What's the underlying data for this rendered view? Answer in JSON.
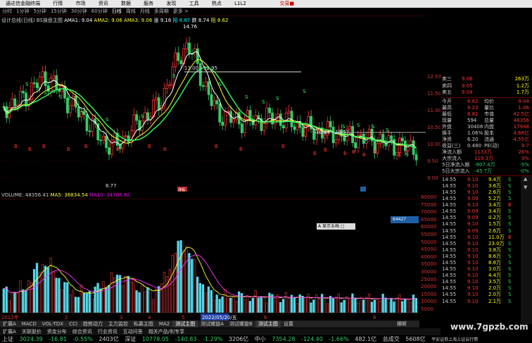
{
  "menubar": {
    "app": "通达信金融终端",
    "items": [
      "行情",
      "市场",
      "资讯",
      "数据",
      "服务",
      "发现",
      "工具",
      "热点",
      "L1L2"
    ],
    "right": "交易■"
  },
  "periods": [
    "分时",
    "1分钟",
    "5分钟",
    "15分钟",
    "30分钟",
    "60分钟",
    "日线",
    "周线",
    "月线",
    "多周期",
    "更多 >"
  ],
  "active_period": "日线",
  "legend_main": {
    "name": "设计总线(日线)",
    "ind": "BS操盘主图",
    "ma1": "AMA1: 9.04",
    "ma2": "AMA2: 9.06",
    "ma3": "AMA3: 9.06",
    "p1": "涨 9.16",
    "p2": "阳 8.87",
    "p3": "跌 8.74",
    "p4": "阳 8.62"
  },
  "main_annotations": {
    "high": "14.76",
    "resist": "13.00 - 12.95",
    "support": "10.59 - 10.57",
    "low": "8.77",
    "label_mid": "8.77",
    "mark": "涨幅"
  },
  "yaxis_main": [
    "12.53",
    "11.50",
    "11.00",
    "10.50",
    "10.00",
    "9.50",
    "9.00"
  ],
  "legend_vol": {
    "name": "VOLUME: 48356.41",
    "ma5": "MA5: 36834.54",
    "ma10": "MA10: 34706.80"
  },
  "yaxis_vol": [
    "80000",
    "75000",
    "70000",
    "65000",
    "60000",
    "55000",
    "50000",
    "45000",
    "40000",
    "35000",
    "30000",
    "25000",
    "20000",
    "15000",
    "10000",
    "5000"
  ],
  "vol_badge": "64427",
  "popup_label": "A 显示五档 ▢",
  "sidepanel": {
    "asks": [
      {
        "l": "卖三",
        "p": "9.06",
        "v": "263万"
      },
      {
        "l": "卖四",
        "p": "9.05",
        "v": "1.2万"
      },
      {
        "l": "卖五",
        "p": "9.04",
        "v": "1.7万"
      }
    ],
    "quote": [
      {
        "k": "今开",
        "v": "8.82",
        "k2": "均价",
        "v2": "9.04"
      },
      {
        "k": "最高",
        "v": "9.23",
        "k2": "量比",
        "v2": "1.06"
      },
      {
        "k": "最低",
        "v": "8.82",
        "k2": "市值",
        "v2": "42.5亿"
      },
      {
        "k": "现量",
        "v": "594",
        "k2": "总量",
        "v2": "48356"
      },
      {
        "k": "外盘",
        "v": "30408",
        "k2": "内盘",
        "v2": "17948"
      },
      {
        "k": "换手",
        "v": "1.06%",
        "k2": "股本",
        "v2": "4.68亿"
      },
      {
        "k": "净资",
        "v": "6.20",
        "k2": "流通",
        "v2": "4.55亿"
      },
      {
        "k": "收益(三)",
        "v": "0.480",
        "k2": "PE(动)",
        "v2": "9.7"
      },
      {
        "k": "净流入额",
        "v": "1133万",
        "k2": "",
        "v2": "26%"
      },
      {
        "k": "大宗流入",
        "v": "119.3万",
        "k2": "",
        "v2": "3%"
      },
      {
        "k": "5日净流入额",
        "v": "-907.4万",
        "k2": "",
        "v2": "-5%"
      },
      {
        "k": "5日大宗流入",
        "v": "-45.7万",
        "k2": "",
        "v2": "-0%"
      }
    ],
    "ticks": [
      {
        "t": "14:55",
        "p": "9.10",
        "n": "9.4万",
        "s": "S"
      },
      {
        "t": "14:55",
        "p": "9.10",
        "n": "3.6万",
        "s": "S"
      },
      {
        "t": "14:55",
        "p": "9.10",
        "n": "2.6万",
        "s": "S"
      },
      {
        "t": "14:55",
        "p": "9.09",
        "n": "5.2万",
        "s": "S"
      },
      {
        "t": "14:55",
        "p": "9.10",
        "n": "3.4万",
        "s": "B"
      },
      {
        "t": "14:55",
        "p": "9.09",
        "n": "3.4万",
        "s": "S"
      },
      {
        "t": "14:55",
        "p": "9.09",
        "n": "0.2万",
        "s": "S"
      },
      {
        "t": "14:55",
        "p": "9.10",
        "n": "1.5万",
        "s": "S"
      },
      {
        "t": "14:55",
        "p": "9.09",
        "n": "2.6万",
        "s": "S"
      },
      {
        "t": "14:55",
        "p": "9.10",
        "n": "11.0万",
        "s": "B"
      },
      {
        "t": "14:55",
        "p": "9.10",
        "n": "23.0万",
        "s": "S"
      },
      {
        "t": "14:55",
        "p": "9.10",
        "n": "3.8万",
        "s": "S"
      },
      {
        "t": "14:55",
        "p": "9.10",
        "n": "8.6万",
        "s": "S"
      },
      {
        "t": "14:55",
        "p": "9.10",
        "n": "8.8万",
        "s": "S"
      },
      {
        "t": "14:55",
        "p": "9.10",
        "n": "3.0万",
        "s": "S"
      },
      {
        "t": "14:55",
        "p": "9.10",
        "n": "4.4万",
        "s": "S"
      },
      {
        "t": "14:55",
        "p": "9.10",
        "n": "3.5万",
        "s": "S"
      },
      {
        "t": "14:55",
        "p": "9.10",
        "n": "2.0万",
        "s": "S"
      },
      {
        "t": "14:55",
        "p": "9.10",
        "n": "2.0万",
        "s": "S"
      },
      {
        "t": "14:55",
        "p": "9.10",
        "n": "2.1万",
        "s": "S"
      }
    ]
  },
  "timeaxis": {
    "left": "2022年",
    "mid_labels": [
      "2",
      "3",
      "4",
      "5"
    ],
    "current": "2022/05/20/五",
    "right": "6",
    "far": "8"
  },
  "tabbar": [
    "扩展A",
    "MACD",
    "VOL-TDX",
    "CCI",
    "趋势动力",
    "主力监控",
    "私募主图",
    "MA2",
    "测试主图",
    "测试螺旋A",
    "测试螺旋B",
    "测试主图",
    "设置"
  ],
  "tabbar_active": "测试主图",
  "tabbar_right": "横断",
  "tabbar2": [
    "扩展A",
    "关联股价",
    "资金分布",
    "综合资讯",
    "行业资讯",
    "互动问答",
    "相关产品/利专享"
  ],
  "statusbar": {
    "sh": "上证",
    "sh_v": "3024.39",
    "sh_c": "-16.81",
    "sh_p": "-0.55%",
    "sh_a": "2403亿",
    "sz": "深证",
    "sz_v": "10778.05",
    "sz_c": "-140.83",
    "sz_p": "-1.29%",
    "sz_a": "3206亿",
    "zx": "中小",
    "zx_v": "7354.28",
    "zx_c": "-124.40",
    "zx_p": "-1.66%",
    "zx_a": "482.1亿",
    "zc": "总成交",
    "zc_v": "5608亿",
    "broker": "平安证券上海上证云行情",
    "right": "黑通信3F10 剧集"
  },
  "watermark": "www.7gpzb.com",
  "colors": {
    "up": "#ff3333",
    "down": "#33cc66",
    "volup": "#cc3333",
    "voldown": "#55d7e8",
    "ma1": "#ffffff",
    "ma2": "#ffff33",
    "ma3": "#33ff66"
  }
}
